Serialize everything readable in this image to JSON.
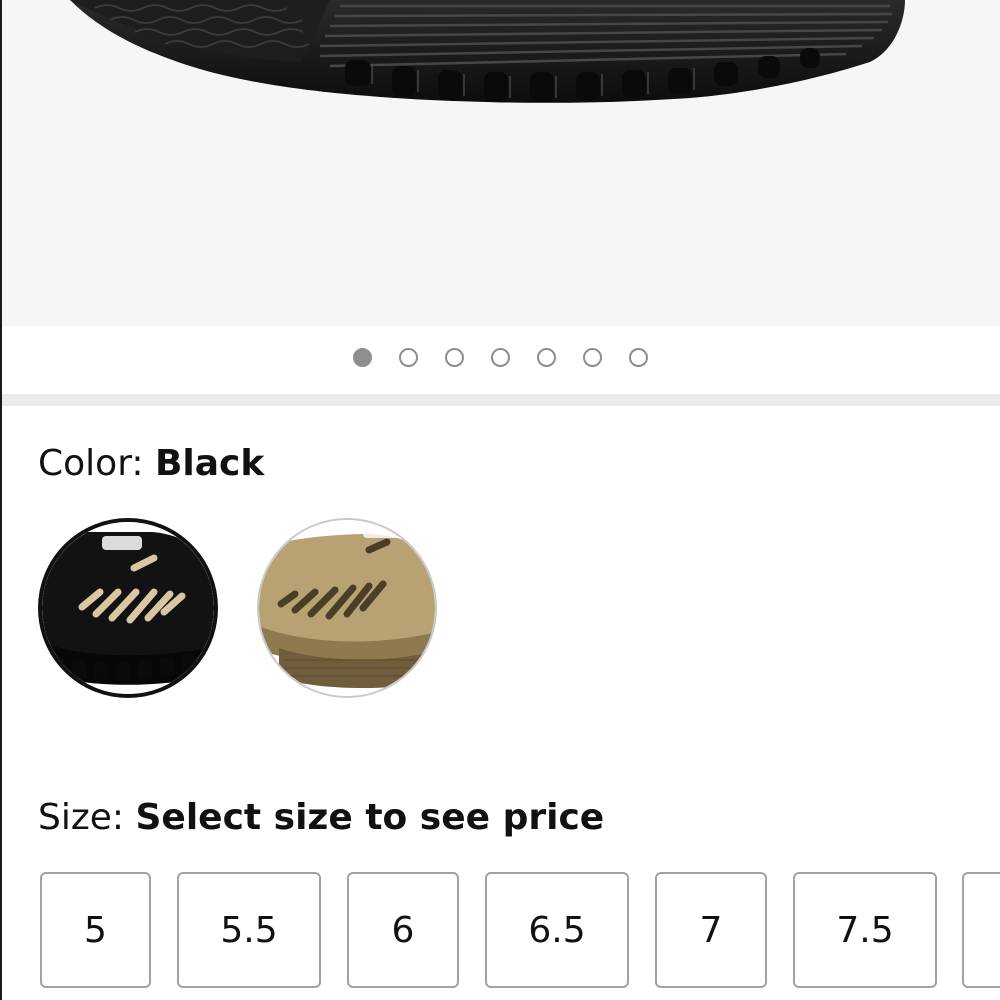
{
  "gallery": {
    "image_count": 7,
    "active_index": 0,
    "dots": [
      "1",
      "2",
      "3",
      "4",
      "5",
      "6",
      "7"
    ]
  },
  "color": {
    "label": "Color:",
    "selected": "Black",
    "options": [
      {
        "name": "Black",
        "selected": true
      },
      {
        "name": "Tan",
        "selected": false
      }
    ]
  },
  "size": {
    "label": "Size:",
    "prompt": "Select size to see price",
    "options": [
      "5",
      "5.5",
      "6",
      "6.5",
      "7",
      "7.5"
    ]
  }
}
